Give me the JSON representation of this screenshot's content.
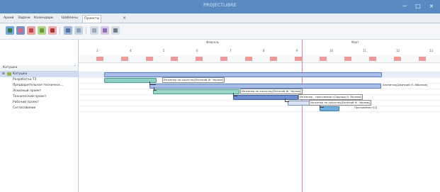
{
  "window": {
    "title": "PROJECTLIBRE"
  },
  "tabs": [
    {
      "label": "Архив"
    },
    {
      "label": "Задачи"
    },
    {
      "label": "Календари"
    },
    {
      "label": "Шаблоны"
    },
    {
      "label": "Проекты"
    }
  ],
  "tree_header": {
    "label": "Катушка"
  },
  "tree": [
    {
      "label": "Катушка"
    },
    {
      "label": "Разработка ТЗ"
    },
    {
      "label": "Предварительная техническ…"
    },
    {
      "label": "Эскизный проект"
    },
    {
      "label": "Технический проект"
    },
    {
      "label": "Рабочий проект"
    },
    {
      "label": "Согласование"
    }
  ],
  "timeline": {
    "months": [
      "Февраль",
      "Март"
    ],
    "weeks": [
      "3",
      "4",
      "5",
      "6",
      "7",
      "8",
      "9",
      "10",
      "11",
      "12",
      "13"
    ]
  },
  "bar_labels": {
    "b1": "Инженер по качеству[Евгений Ф. Чернов]",
    "b2": "Аналитик[Дмитрий Н. Абрамов]",
    "b3": "Инженер по качеству[Евгений Ф. Чернов]",
    "b4": "Инженер - программист[Эдуард Н. Волков]",
    "b5": "Инженер по качеству[Евгений Ф. Чернов]",
    "b6": "Программист[1]"
  }
}
